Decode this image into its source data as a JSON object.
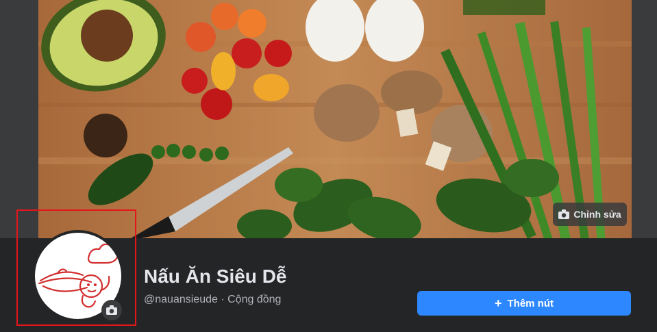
{
  "cover": {
    "edit_label": "Chỉnh sửa",
    "edit_icon": "camera-icon"
  },
  "profile": {
    "name": "Nấu Ăn Siêu Dễ",
    "handle": "@nauansieude",
    "separator": "·",
    "category": "Cộng đồng",
    "avatar_camera_icon": "camera-icon"
  },
  "actions": {
    "add_button_icon": "+",
    "add_button_label": "Thêm nút"
  },
  "colors": {
    "background": "#18191a",
    "band": "#242526",
    "primary_button": "#2d88ff",
    "highlight": "#e3161b",
    "logo": "#d32f2f"
  }
}
